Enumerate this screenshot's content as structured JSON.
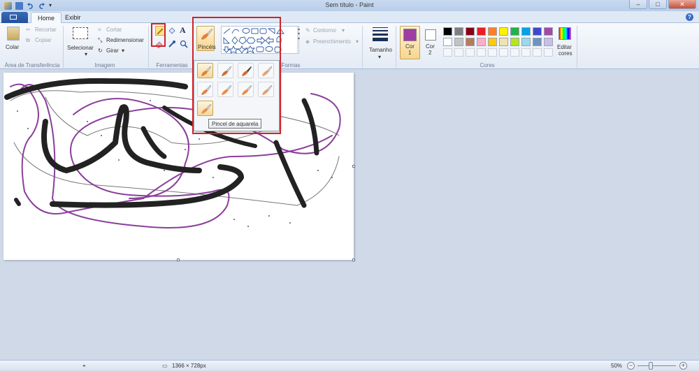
{
  "window": {
    "title": "Sem título - Paint"
  },
  "tabs": [
    {
      "label": "Home"
    },
    {
      "label": "Exibir"
    }
  ],
  "clipboard": {
    "paste": "Colar",
    "cut": "Recortar",
    "copy": "Copiar",
    "group": "Área de Transferência"
  },
  "image": {
    "select": "Selecionar",
    "crop": "Cortar",
    "resize": "Redimensionar",
    "rotate": "Girar",
    "group": "Imagem"
  },
  "tools": {
    "group": "Ferramentas",
    "text_glyph": "A"
  },
  "brushes": {
    "label": "Pincéis",
    "tooltip": "Pincel de aquarela"
  },
  "shapes": {
    "outline": "Contorno",
    "fill": "Preenchimento",
    "group": "Formas"
  },
  "size": {
    "label": "Tamanho"
  },
  "colors": {
    "color1_label": "Cor",
    "color1_num": "1",
    "color2_label": "Cor",
    "color2_num": "2",
    "edit_label": "Editar",
    "edit_label2": "cores",
    "group": "Cores",
    "color1_value": "#a03da3",
    "color2_value": "#ffffff",
    "row1": [
      "#000000",
      "#7f7f7f",
      "#880015",
      "#ed1c24",
      "#ff7f27",
      "#fff200",
      "#22b14c",
      "#00a2e8",
      "#3f48cc",
      "#a349a4"
    ],
    "row2": [
      "#ffffff",
      "#c3c3c3",
      "#b97a57",
      "#ffaec9",
      "#ffc90e",
      "#efe4b0",
      "#b5e61d",
      "#99d9ea",
      "#7092be",
      "#c8bfe7"
    ],
    "row3": [
      "",
      "",
      "",
      "",
      "",
      "",
      "",
      "",
      "",
      ""
    ]
  },
  "status": {
    "dimensions": "1366 × 728px",
    "zoom": "50%"
  }
}
